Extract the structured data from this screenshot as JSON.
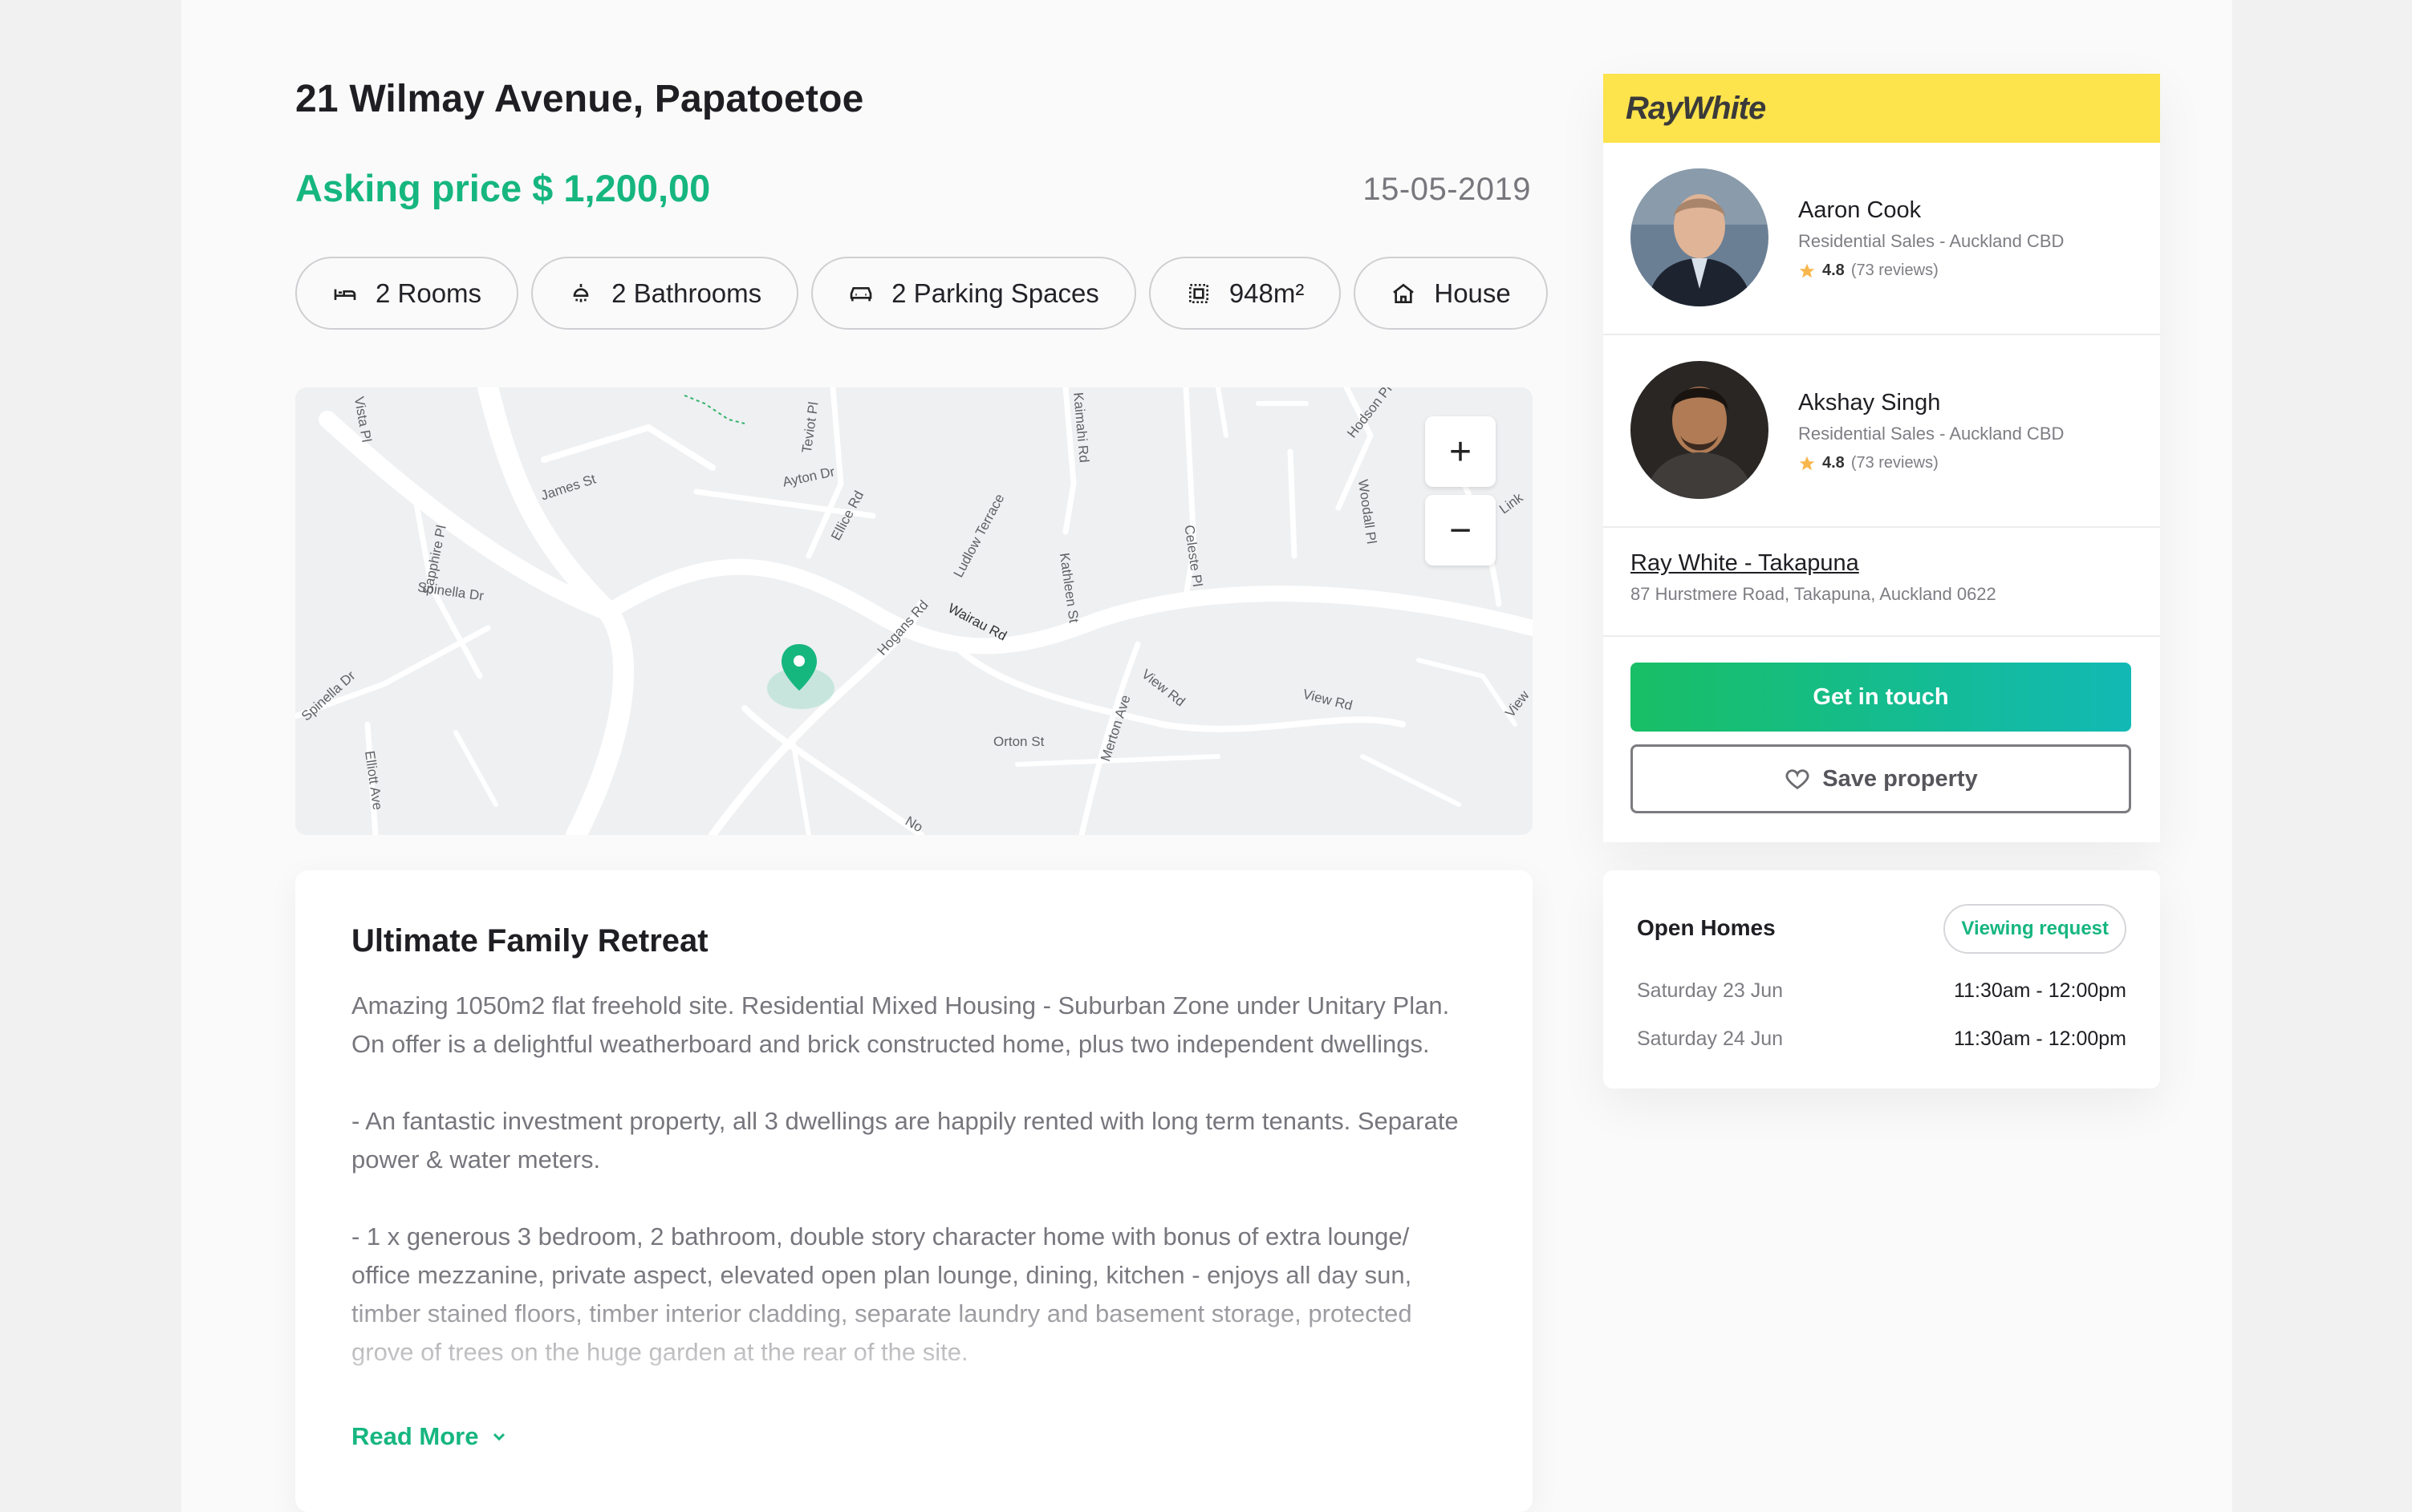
{
  "listing": {
    "title": "21 Wilmay Avenue, Papatoetoe",
    "price": "Asking price $ 1,200,00",
    "date": "15-05-2019"
  },
  "features": [
    {
      "label": "2 Rooms",
      "icon": "bed-icon"
    },
    {
      "label": "2 Bathrooms",
      "icon": "shower-icon"
    },
    {
      "label": "2 Parking Spaces",
      "icon": "car-icon"
    },
    {
      "label": "948m²",
      "icon": "area-icon"
    },
    {
      "label": "House",
      "icon": "house-icon"
    }
  ],
  "map": {
    "streets": [
      "James St",
      "Teviot Pl",
      "Ayton Dr",
      "Ellice Rd",
      "Sapphire Pl",
      "Spinella Dr",
      "Ludlow Terrace",
      "Kathleen St",
      "Celeste Pl",
      "Woodall Pl",
      "Hodson Pl",
      "Kaimahi Rd",
      "Wairau Rd",
      "Hogans Rd",
      "Orton St",
      "Merton Ave",
      "View Rd",
      "View Rd",
      "Elliott Ave",
      "Spinella Dr",
      "Vista Pl",
      "Link",
      "View",
      "No"
    ],
    "zoom_in": "+",
    "zoom_out": "−",
    "pin_color": "#16b67f"
  },
  "description": {
    "title": "Ultimate Family Retreat",
    "paragraphs": [
      "Amazing 1050m2 flat freehold site. Residential Mixed Housing - Suburban Zone under Unitary Plan. On offer is a delightful weatherboard and brick constructed home, plus two independent dwellings.",
      "- An fantastic investment property, all 3 dwellings are happily rented with long term tenants. Separate power & water meters.",
      "- 1 x generous 3 bedroom, 2 bathroom, double story character home with bonus of extra lounge/ office mezzanine, private aspect, elevated open plan lounge, dining, kitchen - enjoys all day sun, timber stained floors, timber interior cladding, separate laundry and basement storage, protected grove of trees on the huge garden at the rear of the site."
    ],
    "read_more": "Read More"
  },
  "agency": {
    "brand": "RayWhite",
    "brand_color": "#fde34c",
    "agents": [
      {
        "name": "Aaron Cook",
        "role": "Residential Sales - Auckland CBD",
        "rating": "4.8",
        "reviews": "(73 reviews)"
      },
      {
        "name": "Akshay Singh",
        "role": "Residential Sales - Auckland CBD",
        "rating": "4.8",
        "reviews": "(73 reviews)"
      }
    ],
    "office_name": "Ray White - Takapuna",
    "office_address": "87 Hurstmere Road, Takapuna, Auckland 0622",
    "cta_primary": "Get in touch",
    "cta_secondary": "Save property"
  },
  "open_homes": {
    "title": "Open Homes",
    "viewing_button": "Viewing request",
    "rows": [
      {
        "day": "Saturday 23 Jun",
        "time": "11:30am - 12:00pm"
      },
      {
        "day": "Saturday 24 Jun",
        "time": "11:30am - 12:00pm"
      }
    ]
  },
  "colors": {
    "accent": "#16b67f",
    "text": "#1e1e23",
    "muted": "#76767d"
  }
}
